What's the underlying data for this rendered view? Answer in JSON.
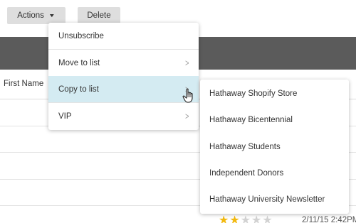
{
  "toolbar": {
    "actions_label": "Actions",
    "delete_label": "Delete"
  },
  "table": {
    "first_name_header": "First Name"
  },
  "actions_menu": {
    "items": [
      {
        "label": "Unsubscribe",
        "has_submenu": false
      },
      {
        "label": "Move to list",
        "has_submenu": true
      },
      {
        "label": "Copy to list",
        "has_submenu": true,
        "highlighted": true
      },
      {
        "label": "VIP",
        "has_submenu": true
      }
    ]
  },
  "copy_submenu": {
    "items": [
      {
        "label": "Hathaway Shopify Store"
      },
      {
        "label": "Hathaway Bicentennial"
      },
      {
        "label": "Hathaway Students"
      },
      {
        "label": "Independent Donors"
      },
      {
        "label": "Hathaway University Newsletter"
      }
    ]
  },
  "row": {
    "rating": 2,
    "rating_max": 5,
    "timestamp": "2/11/15 2:42PM"
  },
  "colors": {
    "button_bg": "#dedede",
    "header_band": "#5b5b5b",
    "highlight": "#d4ebf2",
    "star_filled": "#f2b90f",
    "star_empty": "#d2d2d2"
  },
  "icons": {
    "dropdown": "chevron-down-icon",
    "submenu": "chevron-right-icon",
    "cursor": "hand-pointer-icon",
    "rating": "star-icon"
  }
}
